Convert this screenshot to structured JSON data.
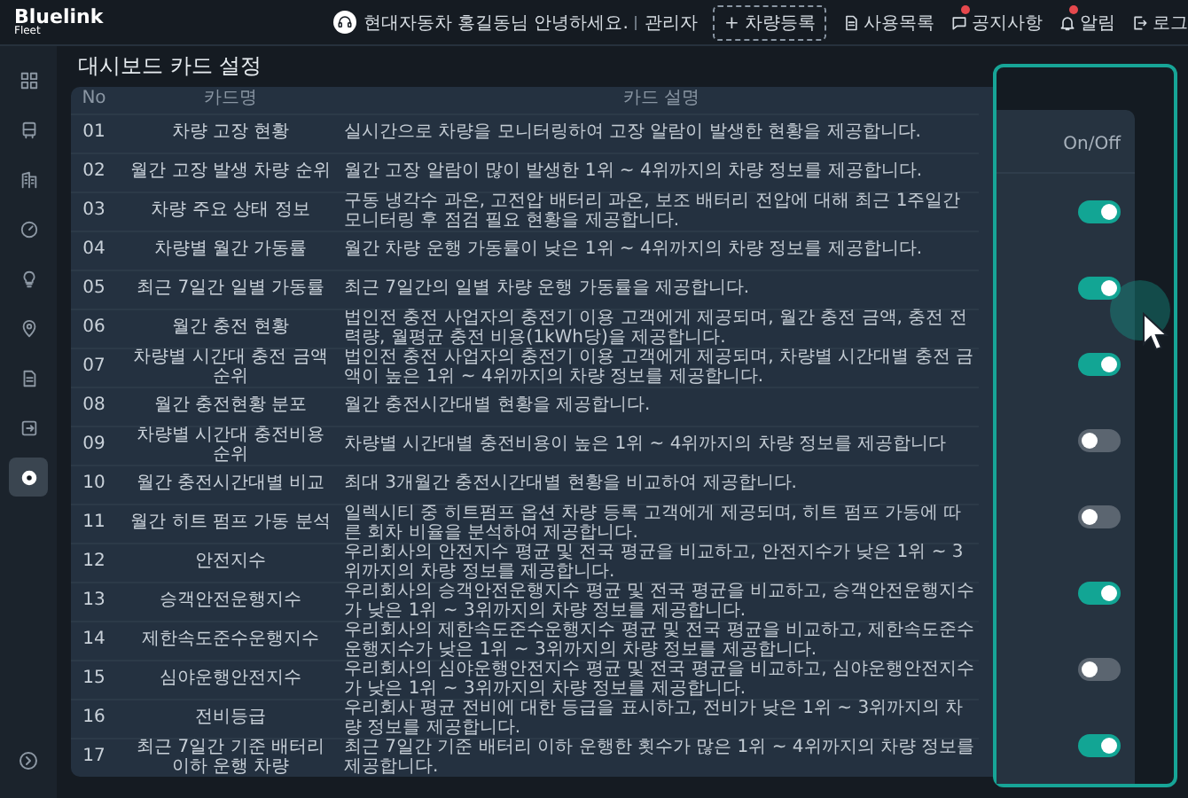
{
  "topbar": {
    "logo": "Bluelink",
    "logo_sub": "Fleet",
    "greeting": "현대자동차 홍길동님 안녕하세요.",
    "role": "관리자",
    "actions": [
      {
        "kind": "outline",
        "label": "+ 차량등록"
      },
      {
        "kind": "icon",
        "label": "사용목록",
        "badge": false
      },
      {
        "kind": "icon",
        "label": "공지사항",
        "badge": true
      },
      {
        "kind": "icon",
        "label": "알림",
        "badge": true
      },
      {
        "kind": "icon",
        "label": "로그",
        "badge": false
      }
    ]
  },
  "sidebar": {
    "items": [
      {
        "selected": false
      },
      {
        "selected": false
      },
      {
        "selected": false
      },
      {
        "selected": false
      },
      {
        "selected": false
      },
      {
        "selected": false
      },
      {
        "selected": false
      },
      {
        "selected": false
      },
      {
        "selected": true
      }
    ]
  },
  "page": {
    "title": "대시보드 카드 설정"
  },
  "table": {
    "columns": [
      "No",
      "카드명",
      "카드 설명"
    ],
    "rows": [
      {
        "no": "01",
        "name": "차량 고장 현황",
        "description": "실시간으로 차량을 모니터링하여 고장 알람이 발생한 현황을 제공합니다."
      },
      {
        "no": "02",
        "name": "월간 고장 발생 차량 순위",
        "description": "월간 고장 알람이 많이 발생한 1위 ~ 4위까지의 차량 정보를 제공합니다."
      },
      {
        "no": "03",
        "name": "차량 주요 상태 정보",
        "description": "구동 냉각수 과온, 고전압 배터리 과온, 보조 배터리 전압에 대해 최근 1주일간 모니터링 후 점검 필요 현황을 제공합니다."
      },
      {
        "no": "04",
        "name": "차량별 월간 가동률",
        "description": "월간 차량 운행 가동률이 낮은 1위 ~ 4위까지의 차량 정보를 제공합니다."
      },
      {
        "no": "05",
        "name": "최근 7일간 일별 가동률",
        "description": "최근 7일간의 일별 차량 운행 가동률을 제공합니다."
      },
      {
        "no": "06",
        "name": "월간 충전 현황",
        "description": "법인전 충전 사업자의 충전기 이용 고객에게 제공되며, 월간 충전 금액, 충전 전력량, 월평균 충전 비용(1kWh당)을 제공합니다."
      },
      {
        "no": "07",
        "name": "차량별 시간대 충전 금액 순위",
        "description": "법인전 충전 사업자의 충전기 이용 고객에게 제공되며, 차량별 시간대별 충전 금액이 높은 1위 ~ 4위까지의 차량 정보를 제공합니다."
      },
      {
        "no": "08",
        "name": "월간 충전현황 분포",
        "description": "월간 충전시간대별 현황을 제공합니다."
      },
      {
        "no": "09",
        "name": "차량별 시간대 충전비용 순위",
        "description": "차량별 시간대별 충전비용이 높은 1위 ~ 4위까지의 차량 정보를 제공합니다"
      },
      {
        "no": "10",
        "name": "월간 충전시간대별 비교",
        "description": "최대 3개월간 충전시간대별 현황을 비교하여 제공합니다."
      },
      {
        "no": "11",
        "name": "월간 히트 펌프 가동 분석",
        "description": "일렉시티 중 히트펌프 옵션 차량 등록 고객에게 제공되며, 히트 펌프 가동에 따른 회차 비율을 분석하여 제공합니다."
      },
      {
        "no": "12",
        "name": "안전지수",
        "description": "우리회사의 안전지수 평균 및 전국 평균을 비교하고, 안전지수가 낮은 1위 ~ 3위까지의 차량 정보를 제공합니다."
      },
      {
        "no": "13",
        "name": "승객안전운행지수",
        "description": "우리회사의 승객안전운행지수 평균 및 전국 평균을 비교하고, 승객안전운행지수가 낮은 1위 ~ 3위까지의 차량 정보를 제공합니다."
      },
      {
        "no": "14",
        "name": "제한속도준수운행지수",
        "description": "우리회사의 제한속도준수운행지수 평균 및 전국 평균을 비교하고, 제한속도준수운행지수가 낮은 1위 ~ 3위까지의 차량 정보를 제공합니다."
      },
      {
        "no": "15",
        "name": "심야운행안전지수",
        "description": "우리회사의 심야운행안전지수 평균 및 전국 평균을 비교하고, 심야운행안전지수가 낮은 1위 ~ 3위까지의 차량 정보를 제공합니다."
      },
      {
        "no": "16",
        "name": "전비등급",
        "description": "우리회사 평균 전비에 대한 등급을 표시하고, 전비가 낮은 1위 ~ 3위까지의 차량 정보를 제공합니다."
      },
      {
        "no": "17",
        "name": "최근 7일간 기준 배터리 이하 운행 차량",
        "description": "최근 7일간 기준 배터리 이하 운행한 횟수가 많은 1위 ~ 4위까지의 차량 정보를 제공합니다."
      }
    ]
  },
  "toggle_callout": {
    "header": "On/Off",
    "toggles": [
      {
        "on": true
      },
      {
        "on": true
      },
      {
        "on": true
      },
      {
        "on": false
      },
      {
        "on": false
      },
      {
        "on": true
      },
      {
        "on": false
      },
      {
        "on": true
      }
    ]
  }
}
